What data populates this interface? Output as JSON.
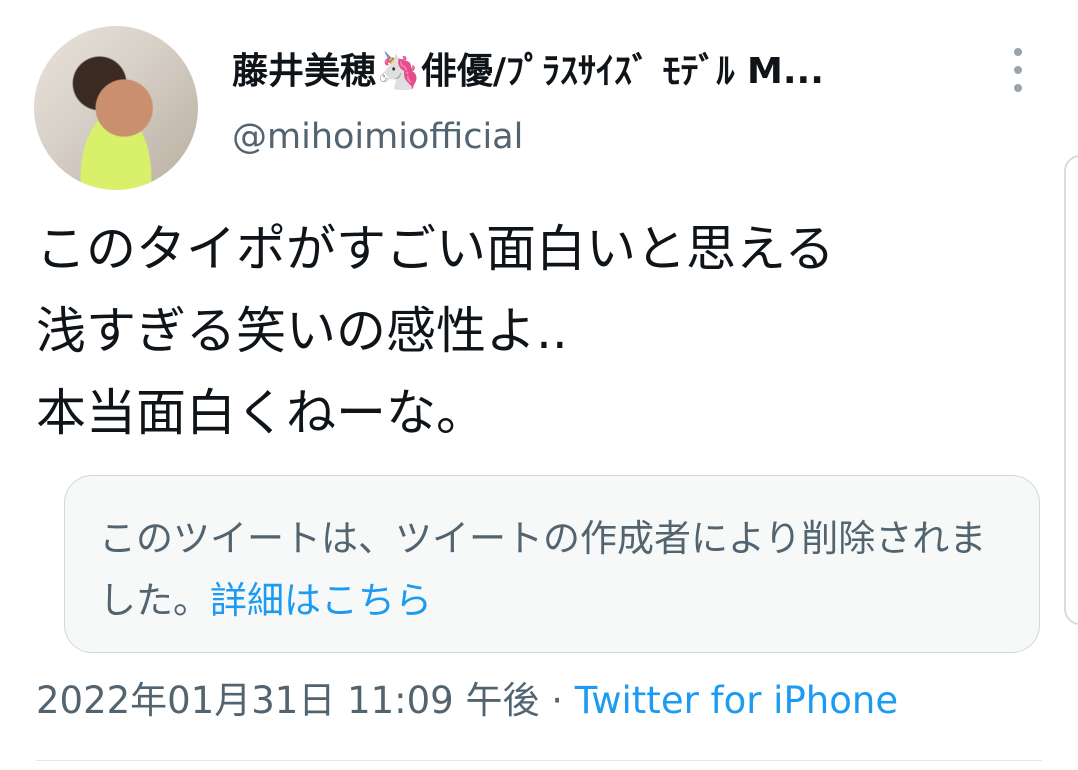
{
  "author": {
    "display_name": "藤井美穂🦄俳優/ﾌﾟﾗｽｻｲｽﾞ ﾓﾃﾞﾙ M...",
    "handle": "@mihoimiofficial"
  },
  "tweet": {
    "text": "このタイポがすごい面白いと思える\n浅すぎる笑いの感性よ..\n本当面白くねーな。"
  },
  "quoted": {
    "text": "このツイートは、ツイートの作成者により削除されました。",
    "link_label": "詳細はこちら"
  },
  "meta": {
    "timestamp": "2022年01月31日 11:09 午後",
    "separator": " · ",
    "source": "Twitter for iPhone"
  },
  "colors": {
    "link": "#1d9bf0",
    "secondary_text": "#536471",
    "primary_text": "#0f1419"
  }
}
